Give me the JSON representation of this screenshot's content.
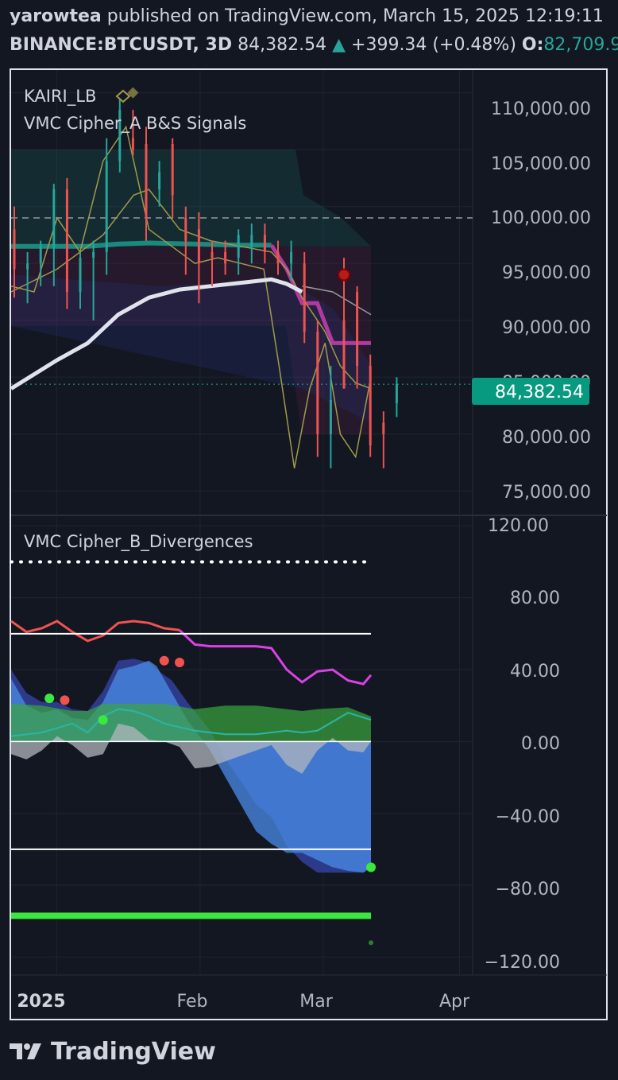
{
  "header": {
    "author": "yarowtea",
    "published_on": "published on TradingView.com, March 15, 2025 12:19:11",
    "symbol": "BINANCE:BTCUSDT, 3D",
    "price": "84,382.54",
    "change_arrow": "▲",
    "change": "+399.34 (+0.48%)",
    "open_label": "O:",
    "open_value": "82,709.9"
  },
  "price_pane": {
    "legend": [
      "KAIRI_LB",
      "VMC Cipher_A B&S Signals"
    ],
    "y_ticks": [
      "110,000.00",
      "105,000.00",
      "100,000.00",
      "95,000.00",
      "90,000.00",
      "80,000.00",
      "75,000.00"
    ],
    "last_price_label": "84,382.54",
    "hidden_tick": "85,000.00"
  },
  "osc_pane": {
    "legend": "VMC Cipher_B_Divergences",
    "y_ticks": [
      "120.00",
      "80.00",
      "40.00",
      "0.00",
      "−40.00",
      "−80.00",
      "−120.00"
    ]
  },
  "x_axis": {
    "labels": [
      "2025",
      "Feb",
      "Mar",
      "Apr"
    ]
  },
  "branding": {
    "logo_text": "TradingView"
  },
  "colors": {
    "background": "#131722",
    "up": "#26a69a",
    "down": "#ef5350",
    "text": "#d1d4dc",
    "ma_white": "#e0e3eb",
    "olive": "#a19a4b",
    "teal_band": "#1b8a7e",
    "purple": "#b03aa0",
    "wave_blue": "#2e3b8f",
    "money_flow": "#3ba63f",
    "rsi_line": "#d942e6",
    "signal_green": "#3ce83f"
  },
  "chart_data": [
    {
      "type": "candlestick",
      "title": "BINANCE:BTCUSDT, 3D",
      "ylim": [
        73000,
        112000
      ],
      "x_range": [
        "2024-12-20",
        "2025-04-04"
      ],
      "last_price": 84382.54,
      "candles": [
        {
          "date": "2024-12-20",
          "o": 98000,
          "h": 100000,
          "l": 92000,
          "c": 94500
        },
        {
          "date": "2024-12-23",
          "o": 94500,
          "h": 96000,
          "l": 91500,
          "c": 95000
        },
        {
          "date": "2024-12-26",
          "o": 95000,
          "h": 97000,
          "l": 93000,
          "c": 96500
        },
        {
          "date": "2024-12-29",
          "o": 96500,
          "h": 102000,
          "l": 93000,
          "c": 101500
        },
        {
          "date": "2025-01-01",
          "o": 101500,
          "h": 102500,
          "l": 91000,
          "c": 92500
        },
        {
          "date": "2025-01-04",
          "o": 92500,
          "h": 96000,
          "l": 91000,
          "c": 95500
        },
        {
          "date": "2025-01-07",
          "o": 95500,
          "h": 97000,
          "l": 90000,
          "c": 96000
        },
        {
          "date": "2025-01-10",
          "o": 96000,
          "h": 106000,
          "l": 94000,
          "c": 104000
        },
        {
          "date": "2025-01-13",
          "o": 104000,
          "h": 109500,
          "l": 103000,
          "c": 108500
        },
        {
          "date": "2025-01-16",
          "o": 106000,
          "h": 108500,
          "l": 104500,
          "c": 105000
        },
        {
          "date": "2025-01-19",
          "o": 105500,
          "h": 107000,
          "l": 97000,
          "c": 99000
        },
        {
          "date": "2025-01-22",
          "o": 101500,
          "h": 104000,
          "l": 100000,
          "c": 103000
        },
        {
          "date": "2025-01-25",
          "o": 105500,
          "h": 106000,
          "l": 99000,
          "c": 101000
        },
        {
          "date": "2025-01-28",
          "o": 99000,
          "h": 100000,
          "l": 94000,
          "c": 97000
        },
        {
          "date": "2025-01-31",
          "o": 98000,
          "h": 99500,
          "l": 91500,
          "c": 95000
        },
        {
          "date": "2025-02-03",
          "o": 96000,
          "h": 97000,
          "l": 93000,
          "c": 95500
        },
        {
          "date": "2025-02-06",
          "o": 96000,
          "h": 97000,
          "l": 94000,
          "c": 95000
        },
        {
          "date": "2025-02-09",
          "o": 95500,
          "h": 98000,
          "l": 94000,
          "c": 97500
        },
        {
          "date": "2025-02-12",
          "o": 96500,
          "h": 98500,
          "l": 95000,
          "c": 97500
        },
        {
          "date": "2025-02-15",
          "o": 97500,
          "h": 98500,
          "l": 95000,
          "c": 96000
        },
        {
          "date": "2025-02-18",
          "o": 96000,
          "h": 97000,
          "l": 94000,
          "c": 95000
        },
        {
          "date": "2025-02-21",
          "o": 95000,
          "h": 97000,
          "l": 93500,
          "c": 96000
        },
        {
          "date": "2025-02-24",
          "o": 95000,
          "h": 96000,
          "l": 88000,
          "c": 89000
        },
        {
          "date": "2025-02-27",
          "o": 89000,
          "h": 90000,
          "l": 78000,
          "c": 80000
        },
        {
          "date": "2025-03-02",
          "o": 80000,
          "h": 86000,
          "l": 77000,
          "c": 83000
        },
        {
          "date": "2025-03-05",
          "o": 90000,
          "h": 95500,
          "l": 84000,
          "c": 84000
        },
        {
          "date": "2025-03-08",
          "o": 92500,
          "h": 93000,
          "l": 84000,
          "c": 86000
        },
        {
          "date": "2025-03-11",
          "o": 86000,
          "h": 87000,
          "l": 78000,
          "c": 79000
        },
        {
          "date": "2025-03-14",
          "o": 81000,
          "h": 82000,
          "l": 77000,
          "c": 80000
        },
        {
          "date": "2025-03-17",
          "o": 82709.9,
          "h": 85000,
          "l": 81500,
          "c": 84382.54
        }
      ],
      "overlays": {
        "ma_white": [
          [
            0,
            84000
          ],
          [
            6,
            86500
          ],
          [
            10,
            88000
          ],
          [
            14,
            90500
          ],
          [
            18,
            92000
          ],
          [
            22,
            92700
          ],
          [
            26,
            93000
          ],
          [
            30,
            93300
          ],
          [
            34,
            93600
          ],
          [
            36,
            93200
          ],
          [
            38,
            92500
          ]
        ],
        "olive_fast": [
          [
            0,
            93000
          ],
          [
            3,
            92500
          ],
          [
            6,
            99000
          ],
          [
            9,
            96000
          ],
          [
            12,
            104000
          ],
          [
            15,
            107000
          ],
          [
            18,
            98000
          ],
          [
            21,
            96500
          ],
          [
            24,
            95000
          ],
          [
            27,
            95500
          ],
          [
            30,
            95000
          ],
          [
            33,
            94500
          ],
          [
            35,
            86000
          ],
          [
            37,
            77000
          ],
          [
            39,
            84000
          ],
          [
            41,
            88000
          ],
          [
            43,
            80000
          ],
          [
            45,
            78000
          ],
          [
            47,
            85000
          ]
        ],
        "olive_slow": [
          [
            0,
            92500
          ],
          [
            6,
            94500
          ],
          [
            12,
            97500
          ],
          [
            16,
            101000
          ],
          [
            18,
            101500
          ],
          [
            22,
            98000
          ],
          [
            26,
            97000
          ],
          [
            30,
            96500
          ],
          [
            34,
            96000
          ],
          [
            36,
            94500
          ],
          [
            38,
            92000
          ],
          [
            41,
            89000
          ],
          [
            43,
            86000
          ],
          [
            45,
            84500
          ],
          [
            47,
            84000
          ]
        ],
        "teal_line": [
          [
            0,
            96500
          ],
          [
            10,
            96500
          ],
          [
            14,
            96700
          ],
          [
            18,
            96800
          ],
          [
            24,
            96700
          ],
          [
            30,
            96600
          ],
          [
            34,
            96600
          ]
        ],
        "purple_line": [
          [
            34,
            96600
          ],
          [
            36,
            94500
          ],
          [
            38,
            91500
          ],
          [
            40,
            91500
          ],
          [
            42,
            88000
          ],
          [
            45,
            88000
          ],
          [
            47,
            88000
          ]
        ],
        "grey_lines": [
          [
            38,
            93000
          ],
          [
            42,
            92500
          ],
          [
            47,
            90500
          ]
        ]
      },
      "bands": {
        "ribbon_top": 105000,
        "ribbon_mid": 96500,
        "ribbon_bottom": 89500
      },
      "dashed_level": 99000,
      "signals": [
        {
          "date": "2025-01-16",
          "type": "diamond",
          "value": 110000
        },
        {
          "date": "2025-03-05",
          "type": "red_dot",
          "value": 94000
        }
      ]
    },
    {
      "type": "area",
      "title": "VMC Cipher_B_Divergences",
      "ylim": [
        -130,
        125
      ],
      "levels": [
        100,
        60,
        0,
        -60
      ],
      "wave1": [
        [
          0,
          40
        ],
        [
          2,
          27
        ],
        [
          4,
          22
        ],
        [
          6,
          22
        ],
        [
          8,
          18
        ],
        [
          10,
          17
        ],
        [
          12,
          28
        ],
        [
          14,
          45
        ],
        [
          16,
          46
        ],
        [
          18,
          44
        ],
        [
          19,
          40
        ],
        [
          21,
          34
        ],
        [
          23,
          22
        ],
        [
          26,
          6
        ],
        [
          28,
          -10
        ],
        [
          30,
          -22
        ],
        [
          32,
          -35
        ],
        [
          34,
          -42
        ],
        [
          36,
          -58
        ],
        [
          38,
          -67
        ],
        [
          40,
          -73
        ],
        [
          42,
          -73
        ],
        [
          44,
          -73
        ],
        [
          46,
          -73
        ],
        [
          47,
          -70
        ]
      ],
      "wave2": [
        [
          0,
          35
        ],
        [
          2,
          20
        ],
        [
          4,
          16
        ],
        [
          6,
          18
        ],
        [
          8,
          13
        ],
        [
          10,
          12
        ],
        [
          12,
          22
        ],
        [
          14,
          40
        ],
        [
          16,
          42
        ],
        [
          18,
          45
        ],
        [
          19,
          42
        ],
        [
          21,
          27
        ],
        [
          23,
          12
        ],
        [
          26,
          -5
        ],
        [
          28,
          -20
        ],
        [
          30,
          -35
        ],
        [
          32,
          -50
        ],
        [
          34,
          -57
        ],
        [
          36,
          -62
        ],
        [
          38,
          -62
        ],
        [
          40,
          -66
        ],
        [
          42,
          -70
        ],
        [
          44,
          -72
        ],
        [
          46,
          -73
        ],
        [
          47,
          -70
        ]
      ],
      "money_flow": [
        [
          0,
          21
        ],
        [
          4,
          20
        ],
        [
          8,
          17
        ],
        [
          10,
          17
        ],
        [
          12,
          21
        ],
        [
          16,
          21
        ],
        [
          20,
          21
        ],
        [
          24,
          18
        ],
        [
          28,
          20
        ],
        [
          32,
          20
        ],
        [
          36,
          18
        ],
        [
          38,
          17
        ],
        [
          40,
          18
        ],
        [
          44,
          19
        ],
        [
          47,
          14
        ]
      ],
      "money_flow_line": [
        [
          0,
          3
        ],
        [
          4,
          5
        ],
        [
          8,
          10
        ],
        [
          10,
          5
        ],
        [
          12,
          14
        ],
        [
          14,
          18
        ],
        [
          16,
          17
        ],
        [
          18,
          14
        ],
        [
          20,
          10
        ],
        [
          24,
          6
        ],
        [
          28,
          4
        ],
        [
          32,
          4
        ],
        [
          36,
          6
        ],
        [
          38,
          5
        ],
        [
          40,
          6
        ],
        [
          44,
          16
        ],
        [
          47,
          12
        ]
      ],
      "grey_area": [
        [
          0,
          -7
        ],
        [
          2,
          -10
        ],
        [
          4,
          -5
        ],
        [
          6,
          3
        ],
        [
          8,
          -2
        ],
        [
          10,
          -9
        ],
        [
          12,
          -7
        ],
        [
          14,
          10
        ],
        [
          16,
          8
        ],
        [
          18,
          1
        ],
        [
          20,
          0
        ],
        [
          22,
          -3
        ],
        [
          24,
          -15
        ],
        [
          26,
          -14
        ],
        [
          28,
          -11
        ],
        [
          30,
          -8
        ],
        [
          32,
          -5
        ],
        [
          34,
          -2
        ],
        [
          36,
          -13
        ],
        [
          38,
          -18
        ],
        [
          40,
          -5
        ],
        [
          42,
          2
        ],
        [
          44,
          -5
        ],
        [
          46,
          -6
        ],
        [
          47,
          0
        ]
      ],
      "rsi_red": [
        [
          0,
          67
        ],
        [
          2,
          61
        ],
        [
          4,
          63
        ],
        [
          6,
          67
        ],
        [
          8,
          61
        ],
        [
          10,
          56
        ],
        [
          12,
          59
        ],
        [
          14,
          66
        ],
        [
          16,
          67
        ],
        [
          18,
          66
        ],
        [
          20,
          63
        ],
        [
          22,
          62
        ]
      ],
      "rsi_purple": [
        [
          22,
          62
        ],
        [
          24,
          54
        ],
        [
          26,
          53
        ],
        [
          28,
          53
        ],
        [
          30,
          53
        ],
        [
          32,
          53
        ],
        [
          34,
          52
        ],
        [
          36,
          40
        ],
        [
          38,
          33
        ],
        [
          40,
          39
        ],
        [
          42,
          40
        ],
        [
          44,
          34
        ],
        [
          46,
          32
        ],
        [
          47,
          37
        ]
      ],
      "dots": [
        [
          5,
          24,
          "#3ce83f"
        ],
        [
          7,
          23,
          "#ef5350"
        ],
        [
          12,
          12,
          "#3ce83f"
        ],
        [
          20,
          45,
          "#ef5350"
        ],
        [
          22,
          44,
          "#ef5350"
        ],
        [
          47,
          -70,
          "#3ce83f"
        ]
      ],
      "signal_line": -97
    }
  ]
}
